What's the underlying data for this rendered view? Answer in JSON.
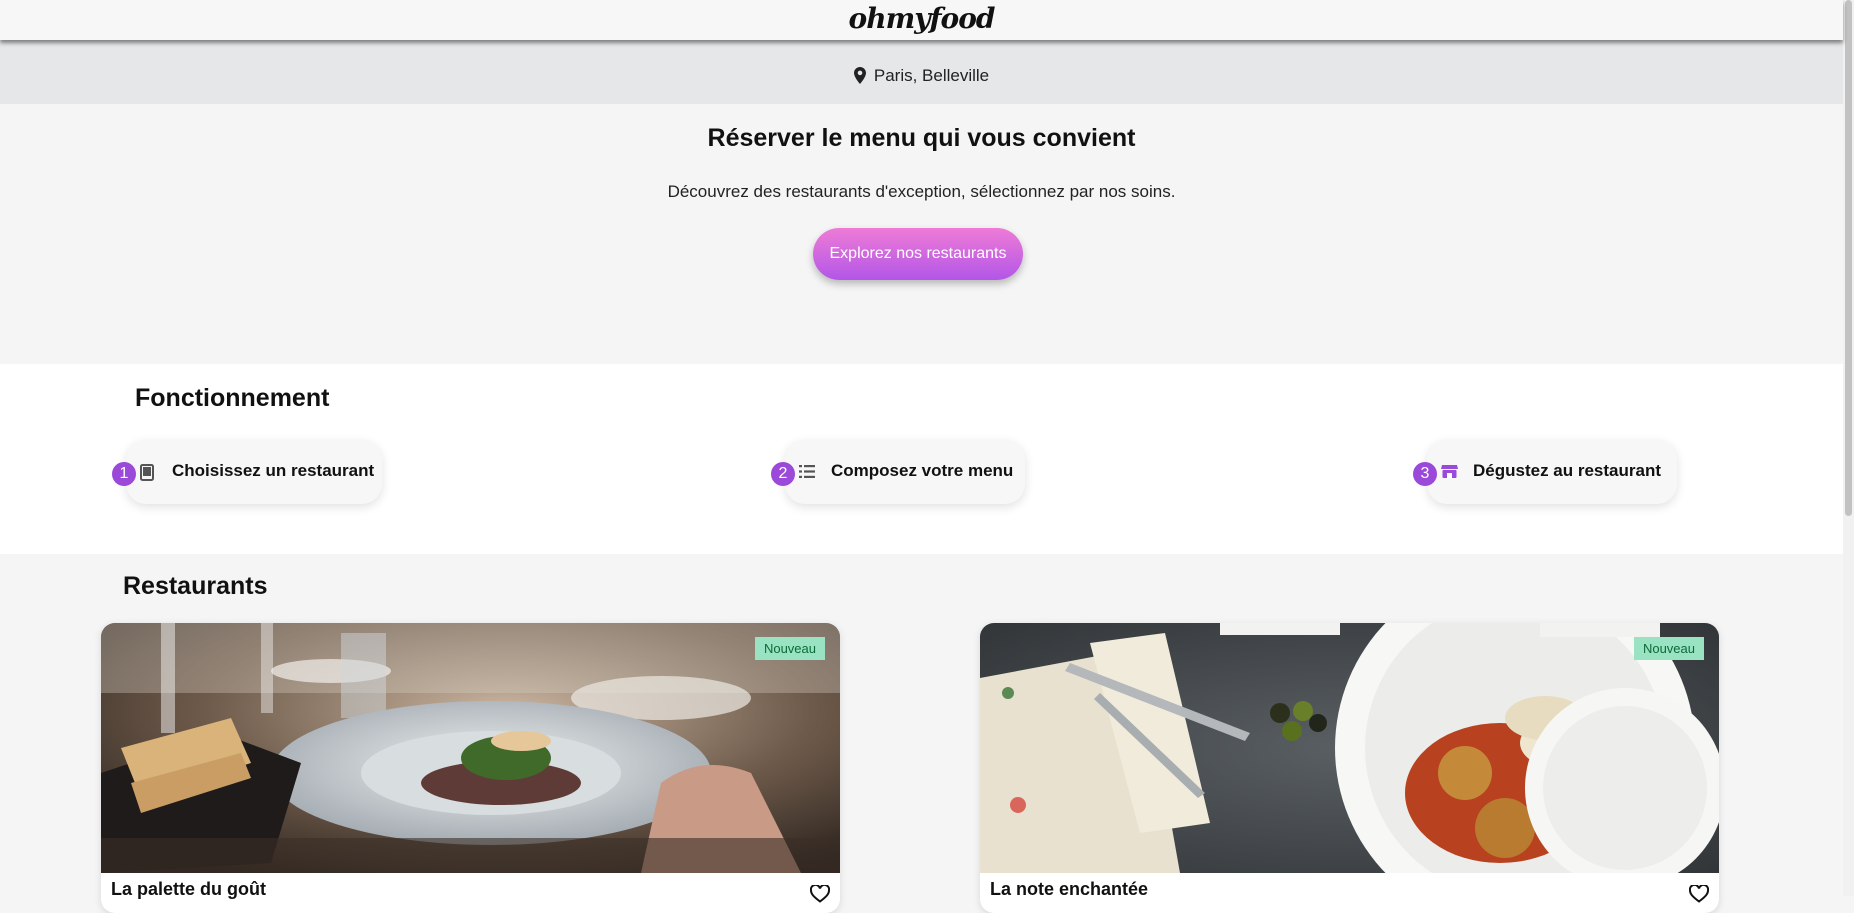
{
  "header": {
    "logo": "ohmyfood"
  },
  "location": {
    "icon": "map-pin-icon",
    "text": "Paris, Belleville"
  },
  "hero": {
    "title": "Réserver le menu qui vous convient",
    "subtitle": "Découvrez des restaurants d'exception, sélectionnez par nos soins.",
    "cta_label": "Explorez nos restaurants",
    "cta_colors": [
      "#ee7bd6",
      "#b356e8"
    ]
  },
  "how_it_works": {
    "title": "Fonctionnement",
    "steps": [
      {
        "number": "1",
        "label": "Choisissez un restaurant",
        "icon": "tablet-icon"
      },
      {
        "number": "2",
        "label": "Composez votre menu",
        "icon": "list-icon"
      },
      {
        "number": "3",
        "label": "Dégustez au restaurant",
        "icon": "store-icon"
      }
    ],
    "accent_color": "#9b49d8"
  },
  "restaurants": {
    "title": "Restaurants",
    "cards": [
      {
        "badge": "Nouveau",
        "name": "La palette du goût",
        "favorite_icon": "heart-outline-icon"
      },
      {
        "badge": "Nouveau",
        "name": "La note enchantée",
        "favorite_icon": "heart-outline-icon"
      }
    ],
    "badge_color": "#99e2c2"
  }
}
